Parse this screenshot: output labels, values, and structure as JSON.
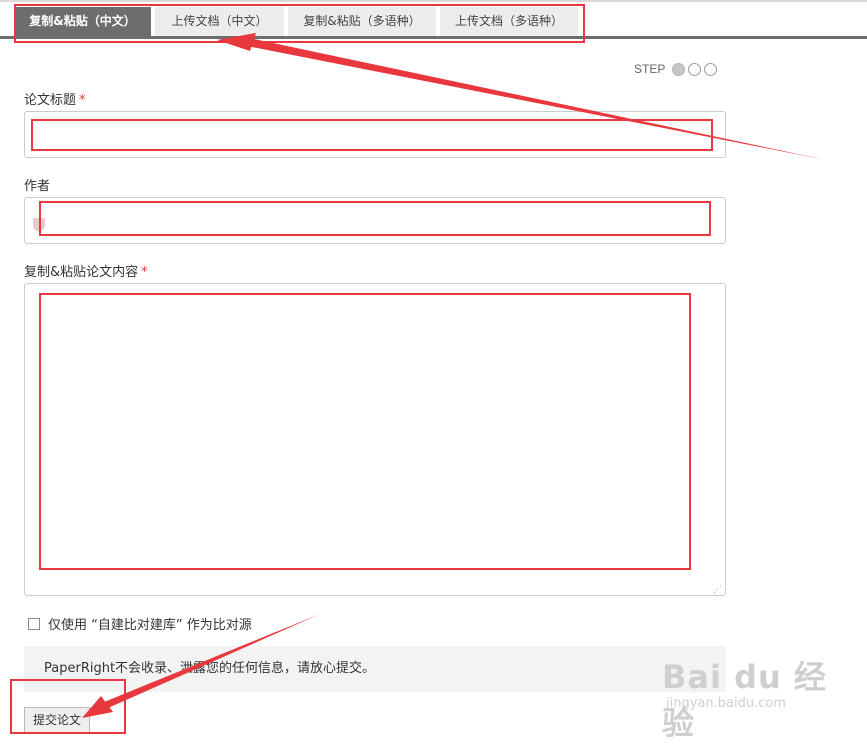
{
  "tabs": [
    {
      "label": "复制&粘贴（中文）",
      "active": true
    },
    {
      "label": "上传文档（中文）",
      "active": false
    },
    {
      "label": "复制&粘贴（多语种）",
      "active": false
    },
    {
      "label": "上传文档（多语种）",
      "active": false
    }
  ],
  "step": {
    "label": "STEP",
    "current": 1,
    "total": 3
  },
  "form": {
    "title_label": "论文标题",
    "title_value": "",
    "author_label": "作者",
    "author_value": "",
    "content_label": "复制&粘贴论文内容",
    "content_value": "",
    "required_mark": "*",
    "checkbox_label": "仅使用 “自建比对建库” 作为比对源",
    "checkbox_checked": false,
    "notice": "PaperRight不会收录、泄露您的任何信息，请放心提交。",
    "submit_label": "提交论文"
  },
  "watermark": {
    "logo": "Bai du 经验",
    "url": "jingyan.baidu.com"
  },
  "colors": {
    "annotation": "#e8383d",
    "tab_active": "#6d6d6d",
    "required": "#e03b3b"
  }
}
